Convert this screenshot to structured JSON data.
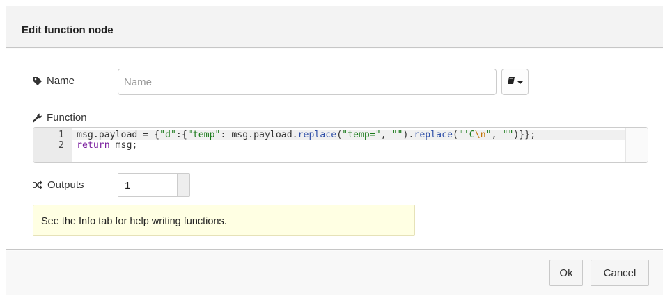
{
  "dialog": {
    "title": "Edit function node"
  },
  "name_field": {
    "label": "Name",
    "icon": "tag-icon",
    "placeholder": "Name",
    "value": ""
  },
  "library_button": {
    "icon": "book-icon"
  },
  "function_field": {
    "label": "Function",
    "icon": "wrench-icon",
    "lines": [
      {
        "number": "1",
        "text": "msg.payload = {\"d\":{\"temp\": msg.payload.replace(\"temp=\", \"\").replace(\"'C\\n\", \"\")}};"
      },
      {
        "number": "2",
        "text": "return msg;"
      }
    ]
  },
  "outputs_field": {
    "label": "Outputs",
    "icon": "random-icon",
    "value": "1"
  },
  "tip": {
    "text": "See the Info tab for help writing functions."
  },
  "footer": {
    "ok_label": "Ok",
    "cancel_label": "Cancel"
  },
  "colors": {
    "keyword": "#7a1e9e",
    "string": "#1a7a1a",
    "function": "#2f4fa8",
    "escape": "#c27300",
    "tip_background": "#ffffe3"
  }
}
